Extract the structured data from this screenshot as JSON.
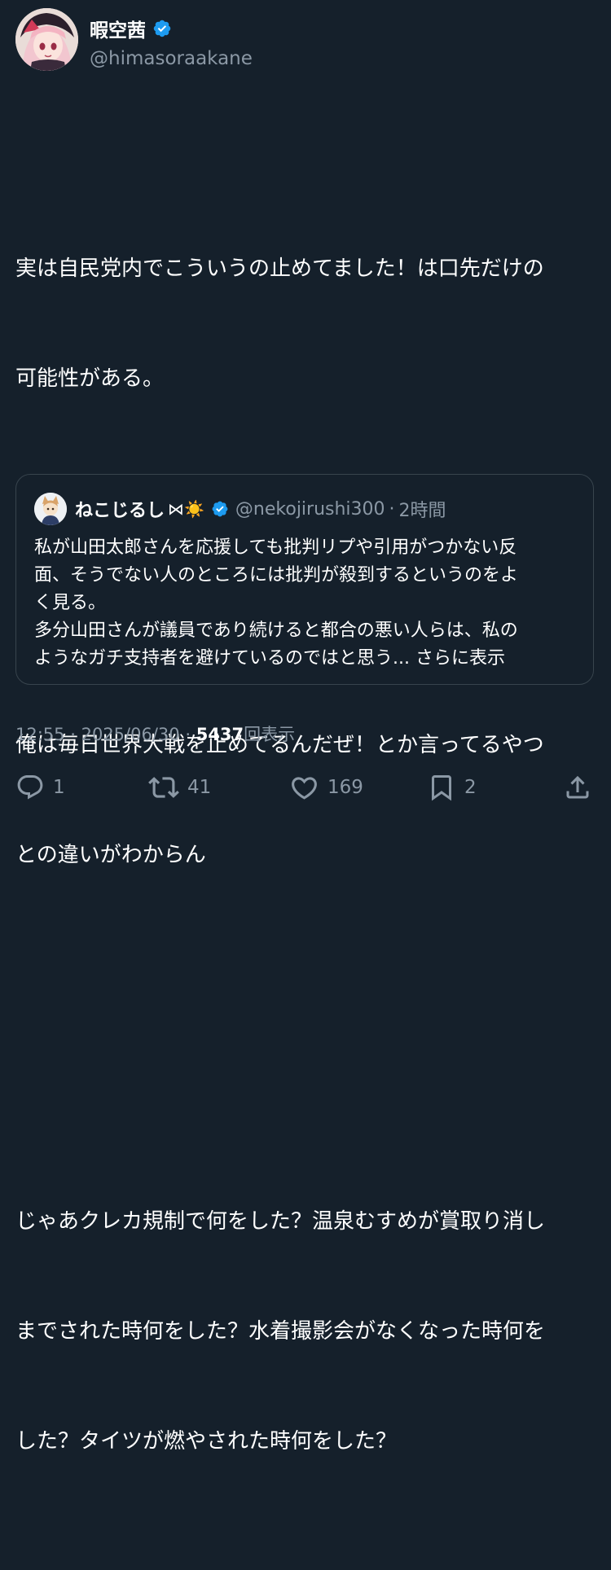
{
  "author": {
    "display_name": "暇空茜",
    "handle": "@himasoraakane",
    "verified": true,
    "avatar_icon": "avatar-anime-girl"
  },
  "tweet": {
    "paragraphs": [
      [
        "実は自民党内でこういうの止めてました！は口先だけの",
        "可能性がある。"
      ],
      [
        "俺は毎日世界大戦を止めてるんだぜ！とか言ってるやつ",
        "との違いがわからん"
      ],
      [
        "じゃあクレカ規制で何をした？温泉むすめが賞取り消し",
        "までされた時何をした？水着撮影会がなくなった時何を",
        "した？タイツが燃やされた時何をした？"
      ]
    ]
  },
  "quote": {
    "display_name": "ねこじるし",
    "emoji": "⋈☀️",
    "handle": "@nekojirushi300",
    "time": "2時間",
    "separator": "·",
    "lines": [
      "私が山田太郎さんを応援しても批判リプや引用がつかない反",
      "面、そうでない人のところには批判が殺到するというのをよ",
      "く見る。",
      "多分山田さんが議員であり続けると都合の悪い人らは、私の"
    ],
    "last_line": "ようなガチ支持者を避けているのではと思う...",
    "show_more": "さらに表示"
  },
  "meta": {
    "time": "12:55",
    "date": "2025/06/30",
    "separator": "·",
    "views_count": "5437",
    "views_label": "回表示"
  },
  "actions": {
    "reply_count": "1",
    "retweet_count": "41",
    "like_count": "169",
    "bookmark_count": "2"
  },
  "colors": {
    "background": "#15202b",
    "text": "#ffffff",
    "secondary": "#8b98a5",
    "verified": "#1d9bf0",
    "border": "#38444d"
  }
}
